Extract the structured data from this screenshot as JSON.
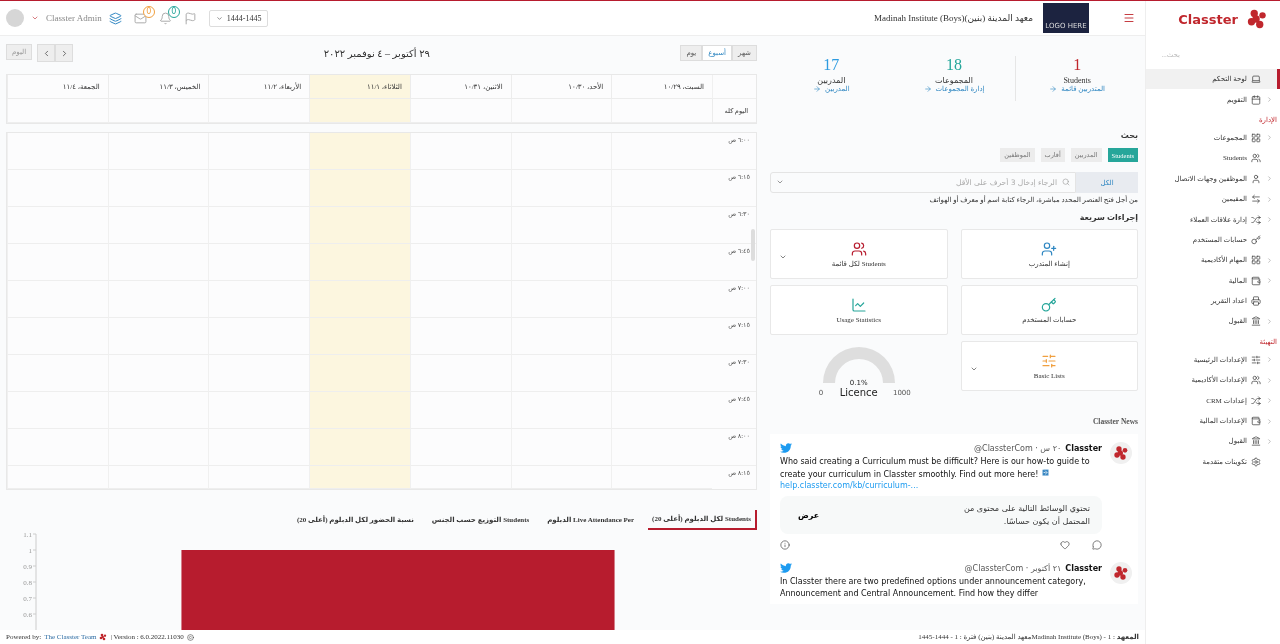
{
  "top_bar": {
    "user_name": "Classter Admin",
    "mail_badge": "0",
    "notifications_badge": "0",
    "year_select": "1444-1445",
    "institute": "Madinah Institute (Boys)معهد المدينة (بنين)",
    "logo_text": "LOGO HERE"
  },
  "sidebar": {
    "brand": "Classter",
    "search_placeholder": "بحث...",
    "sections": [
      {
        "items": [
          {
            "label": "لوحة التحكم",
            "selected": true,
            "has_submenu": false
          },
          {
            "label": "التقويم",
            "selected": false,
            "has_submenu": true
          }
        ]
      },
      {
        "title": "الإدارة",
        "items": [
          {
            "label": "المجموعات",
            "selected": false,
            "has_submenu": true
          },
          {
            "label": "Students",
            "selected": false,
            "has_submenu": false
          },
          {
            "label": "الموظفين وجهات الاتصال",
            "selected": false,
            "has_submenu": true
          },
          {
            "label": "المقيمين",
            "selected": false,
            "has_submenu": true
          },
          {
            "label": "إدارة علاقات العملاء",
            "selected": false,
            "has_submenu": true
          },
          {
            "label": "حسابات المستخدم",
            "selected": false,
            "has_submenu": false
          },
          {
            "label": "المهام الأكاديمية",
            "selected": false,
            "has_submenu": true
          },
          {
            "label": "المالية",
            "selected": false,
            "has_submenu": true
          },
          {
            "label": "اعداد التقرير",
            "selected": false,
            "has_submenu": false
          },
          {
            "label": "القبول",
            "selected": false,
            "has_submenu": true
          }
        ]
      },
      {
        "title": "التهيئة",
        "items": [
          {
            "label": "الإعدادات الرئيسية",
            "selected": false,
            "has_submenu": true
          },
          {
            "label": "الإعدادات الأكاديمية",
            "selected": false,
            "has_submenu": true
          },
          {
            "label": "إعدادات CRM",
            "selected": false,
            "has_submenu": true
          },
          {
            "label": "الإعدادات المالية",
            "selected": false,
            "has_submenu": true
          },
          {
            "label": "القبول",
            "selected": false,
            "has_submenu": true
          },
          {
            "label": "تكوينات متقدمة",
            "selected": false,
            "has_submenu": false
          }
        ]
      }
    ]
  },
  "calendar": {
    "today_button": "اليوم",
    "title": "٢٩ أكتوبر – ٤ نوفمبر ٢٠٢٢",
    "views": [
      {
        "label": "شهر",
        "selected": false
      },
      {
        "label": "أسبوع",
        "selected": true
      },
      {
        "label": "يوم",
        "selected": false
      }
    ],
    "days": [
      {
        "label": "السبت، ١٠/٢٩",
        "today": false
      },
      {
        "label": "الأحد، ١٠/٣٠",
        "today": false
      },
      {
        "label": "الاثنين، ١٠/٣١",
        "today": false
      },
      {
        "label": "الثلاثاء، ١١/١",
        "today": true
      },
      {
        "label": "الأربعاء، ١١/٢",
        "today": false
      },
      {
        "label": "الخميس، ١١/٣",
        "today": false
      },
      {
        "label": "الجمعة، ١١/٤",
        "today": false
      }
    ],
    "all_day_label": "اليوم كله",
    "times": [
      "٦:٠٠ ص",
      "٦:١٥ ص",
      "٦:٣٠ ص",
      "٦:٤٥ ص",
      "٧:٠٠ ص",
      "٧:١٥ ص",
      "٧:٣٠ ص",
      "٧:٤٥ ص",
      "٨:٠٠ ص",
      "٨:١٥ ص"
    ]
  },
  "charts": {
    "tabs": [
      {
        "label": "Students لكل الدبلوم (أعلى 20)",
        "selected": true
      },
      {
        "label": "Live Attendance Per الدبلوم",
        "selected": false
      },
      {
        "label": "Students التوزيع حسب الجنس",
        "selected": false
      },
      {
        "label": "نسبة الحضور لكل الدبلوم (أعلى 20)",
        "selected": false
      }
    ],
    "chart_data": {
      "type": "bar",
      "series": [
        {
          "color": "#b71c2e",
          "values": [
            1
          ]
        }
      ],
      "ylim": [
        0.5,
        1.1
      ],
      "yticks": [
        0.6,
        0.7,
        0.8,
        0.9,
        1,
        1.1
      ]
    }
  },
  "stats": [
    {
      "value": "1",
      "label": "Students",
      "link": "المتدربين قائمة",
      "color": "#c0272d"
    },
    {
      "value": "18",
      "label": "المجموعات",
      "link": "إدارة المجموعات",
      "color": "#26a69a"
    },
    {
      "value": "17",
      "label": "المدربين",
      "link": "المدربين",
      "color": "#2e9be0"
    }
  ],
  "search": {
    "title": "بحث",
    "tabs": [
      {
        "label": "Students",
        "selected": true
      },
      {
        "label": "المدربين",
        "selected": false
      },
      {
        "label": "أقارب",
        "selected": false
      },
      {
        "label": "الموظفين",
        "selected": false
      }
    ],
    "scope": "الكل",
    "placeholder": "الرجاء إدخال 3 أحرف على الأقل",
    "hint": "من أجل فتح العنصر المحدد مباشرة، الرجاء كتابة اسم أو معرف أو الهواتف"
  },
  "quick_actions": {
    "title": "إجراءات سريعة",
    "items": [
      {
        "kind": "action",
        "label": "إنشاء المتدرب",
        "has_menu": false
      },
      {
        "kind": "action",
        "label": "Students لكل قائمة",
        "has_menu": true
      },
      {
        "kind": "action",
        "label": "حسابات المستخدم",
        "has_menu": false
      },
      {
        "kind": "action",
        "label": "Usage Statistics",
        "has_menu": false
      },
      {
        "kind": "action",
        "label": "Basic Lists",
        "has_menu": true
      },
      {
        "kind": "gauge",
        "reading": "0.1%",
        "label": "Licence",
        "min": "0",
        "max": "1000"
      }
    ]
  },
  "news": {
    "title": "Classter News",
    "tweets": [
      {
        "author": "Classter",
        "meta": "@ClassterCom · ٢٠ س",
        "text": "Who said creating a Curriculum must be difficult? Here is our how-to guide to create your curriculum in Classter smoothly. Find out more here!",
        "link": "help.classter.com/kb/curriculum-...",
        "sensitive_notice": "تحتوي الوسائط التالية على محتوى من المحتمل أن يكون حساسًا.",
        "show_button": "عرض"
      },
      {
        "author": "Classter",
        "meta": "@ClassterCom · ٢١ أكتوبر",
        "text": "In Classter there are two predefined options under announcement category, Announcement and Central Announcement. Find how they differ"
      }
    ]
  },
  "footer": {
    "powered_by": "Powered by:",
    "team_link": "The Classter Team",
    "version": "| Version : 6.0.2022.11030",
    "institute_info": "**المعهد** : 1 - Madinah Institute (Boys)معهد المدينة (بنين) فترة : 1 - 1444-1445"
  }
}
